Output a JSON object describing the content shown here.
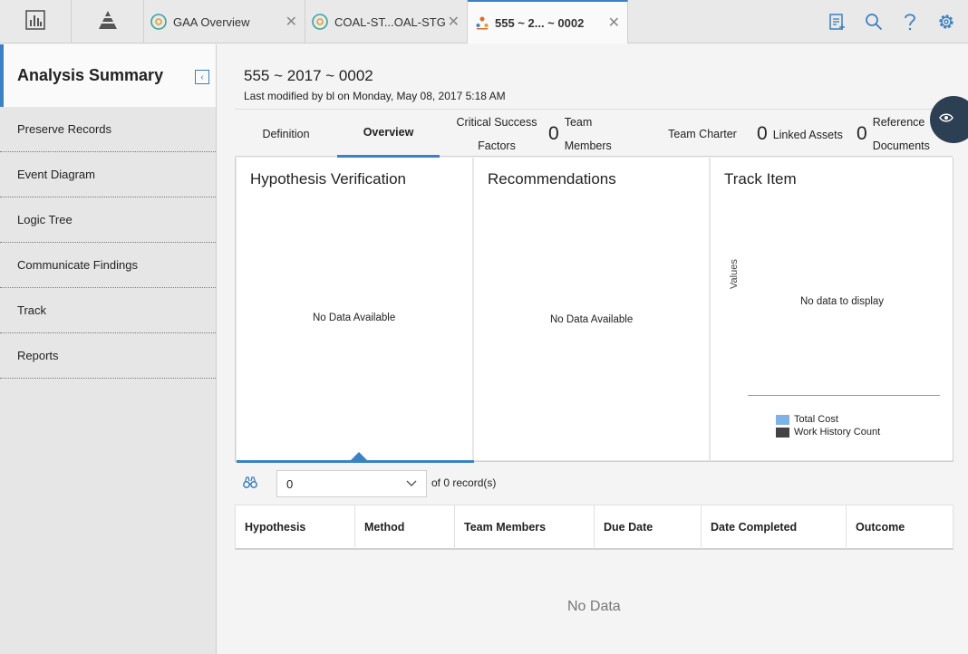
{
  "topbar": {
    "tabs": [
      {
        "label": "GAA Overview",
        "icon": "circle-arrows-icon"
      },
      {
        "label": "COAL-ST...OAL-STG",
        "icon": "circle-arrows-icon"
      },
      {
        "label": "555 ~ 2... ~ 0002",
        "icon": "rca-people-icon"
      }
    ],
    "close_glyph": "✕"
  },
  "sidebar": {
    "title": "Analysis Summary",
    "items": [
      {
        "label": "Preserve Records"
      },
      {
        "label": "Event Diagram"
      },
      {
        "label": "Logic Tree"
      },
      {
        "label": "Communicate Findings"
      },
      {
        "label": "Track"
      },
      {
        "label": "Reports"
      }
    ]
  },
  "record": {
    "title": "555 ~ 2017 ~ 0002",
    "subtitle": "Last modified by bl on Monday, May 08, 2017 5:18 AM"
  },
  "tabs": {
    "definition": "Definition",
    "overview": "Overview",
    "csf_line1": "Critical Success",
    "csf_line2": "Factors",
    "team_count": "0",
    "team_line1": "Team",
    "team_line2": "Members",
    "charter": "Team Charter",
    "linked_count": "0",
    "linked": "Linked Assets",
    "ref_count": "0",
    "ref_line1": "Reference",
    "ref_line2": "Documents"
  },
  "panels": {
    "hypothesis": {
      "title": "Hypothesis Verification",
      "empty": "No Data Available"
    },
    "recommendations": {
      "title": "Recommendations",
      "empty": "No Data Available"
    },
    "track": {
      "title": "Track Item",
      "empty": "No data to display",
      "y_label": "Values",
      "legend": [
        {
          "label": "Total Cost",
          "color": "#7fb2e5"
        },
        {
          "label": "Work History Count",
          "color": "#434343"
        }
      ]
    }
  },
  "pager": {
    "selected": "0",
    "of_label": "of 0",
    "records_label": "record(s)"
  },
  "grid": {
    "columns": [
      "Hypothesis",
      "Method",
      "Team Members",
      "Due Date",
      "Date Completed",
      "Outcome"
    ],
    "empty": "No Data"
  },
  "colors": {
    "accent": "#3b82c4",
    "floating_button": "#2d3f52"
  }
}
